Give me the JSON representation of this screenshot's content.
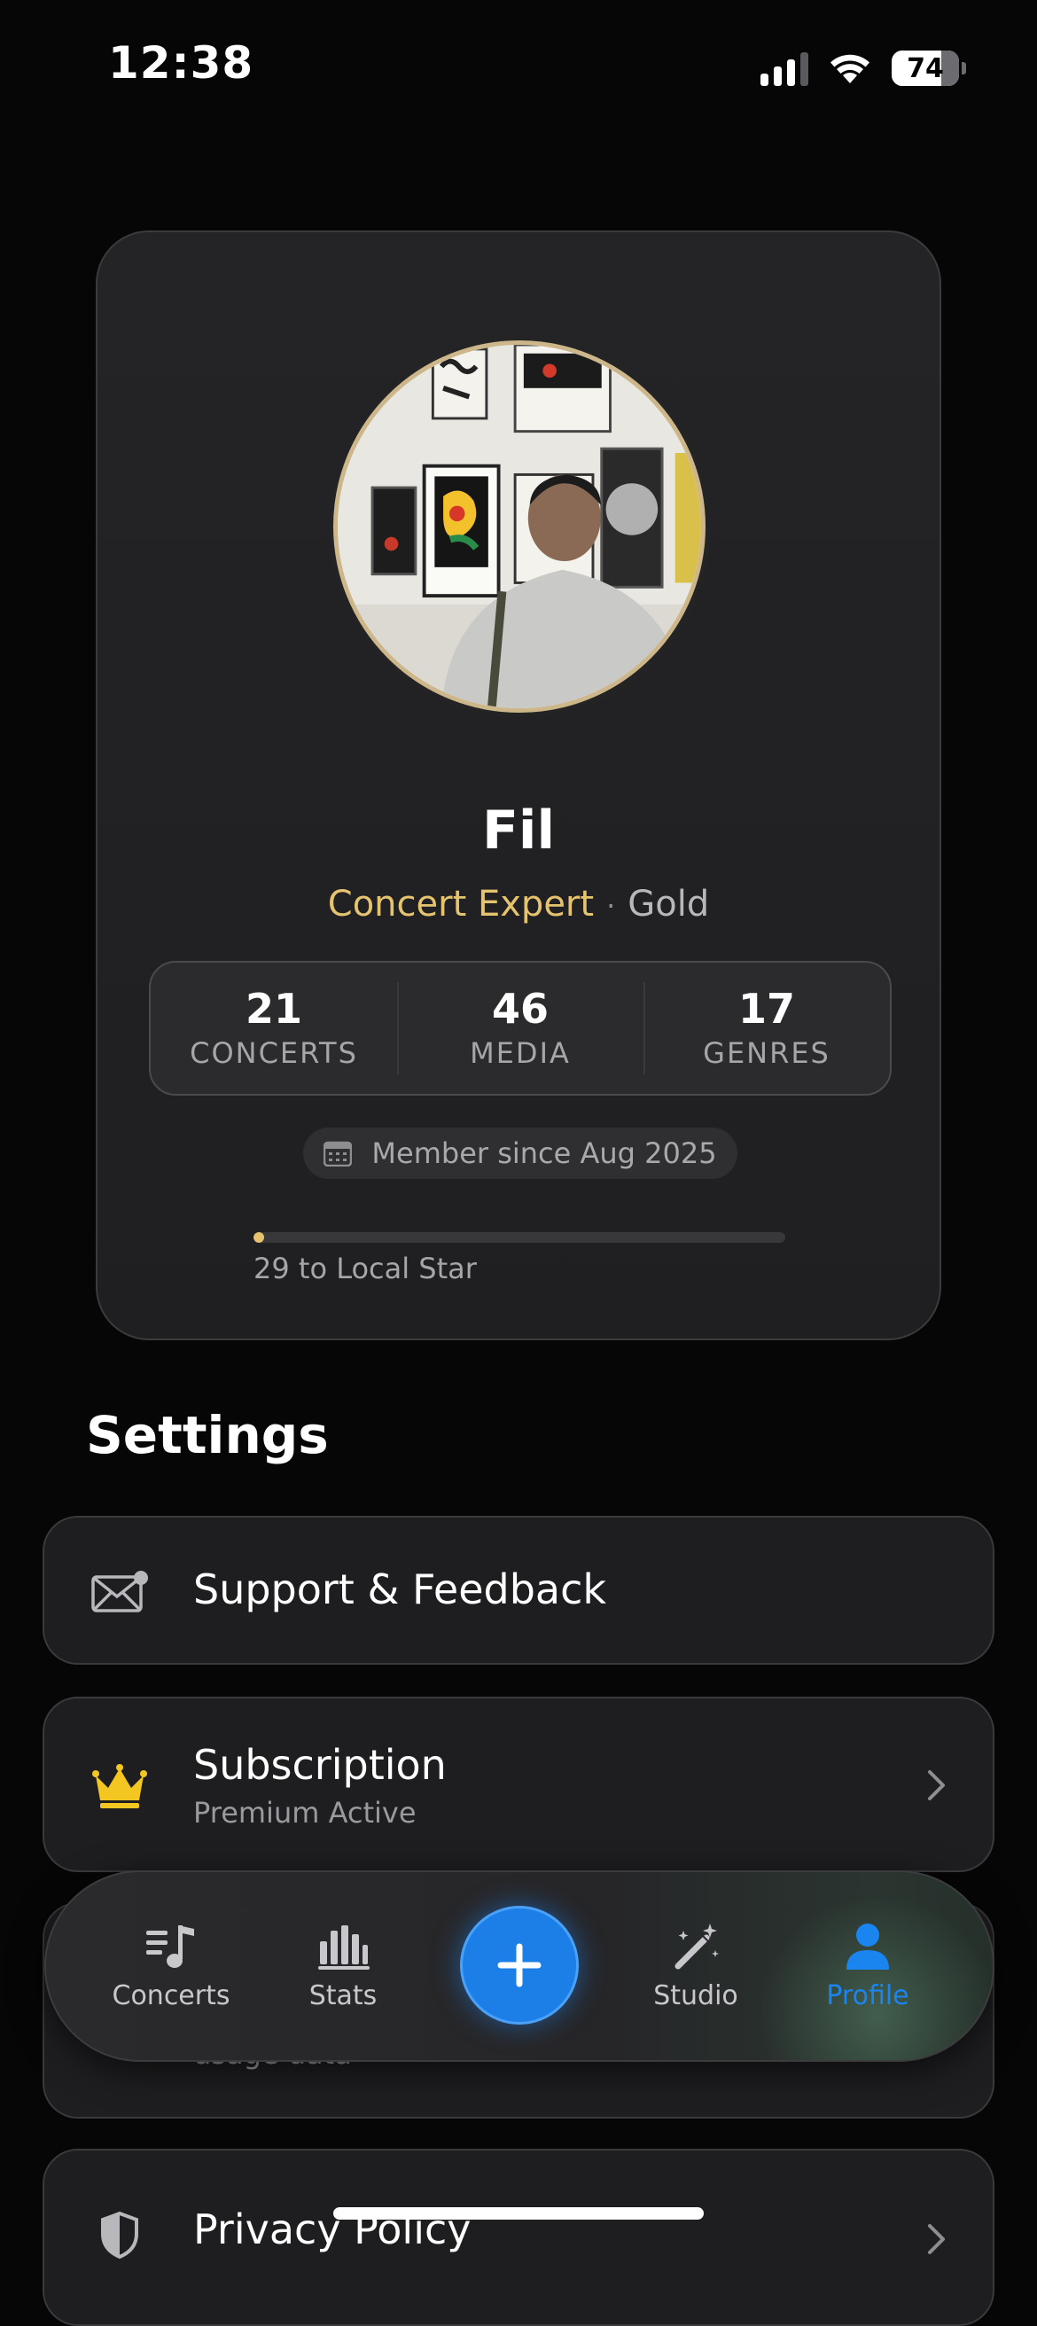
{
  "status_bar": {
    "time": "12:38",
    "battery": "74"
  },
  "profile": {
    "name": "Fil",
    "rank_title": "Concert Expert",
    "separator": "·",
    "tier": "Gold",
    "stats": [
      {
        "value": "21",
        "label": "CONCERTS"
      },
      {
        "value": "46",
        "label": "MEDIA"
      },
      {
        "value": "17",
        "label": "GENRES"
      }
    ],
    "member_since": "Member since Aug 2025",
    "progress_fraction": 0.02,
    "progress_label": "29 to Local Star"
  },
  "settings": {
    "title": "Settings",
    "rows": [
      {
        "title": "Support & Feedback",
        "icon": "mail-icon"
      },
      {
        "title": "Subscription",
        "subtitle": "Premium Active",
        "icon": "crown-icon"
      },
      {
        "subtitle": "usage data"
      },
      {
        "title": "Privacy Policy",
        "icon": "shield-icon"
      }
    ]
  },
  "tab_bar": {
    "tabs": [
      {
        "label": "Concerts",
        "icon": "music-list-icon"
      },
      {
        "label": "Stats",
        "icon": "bar-chart-icon"
      },
      {
        "label": "Studio",
        "icon": "magic-wand-icon"
      },
      {
        "label": "Profile",
        "icon": "person-icon"
      }
    ],
    "active": "Profile",
    "accent_color": "#1a84ef"
  },
  "colors": {
    "gold": "#e6c46f",
    "background": "#060607",
    "card": "#242426"
  }
}
